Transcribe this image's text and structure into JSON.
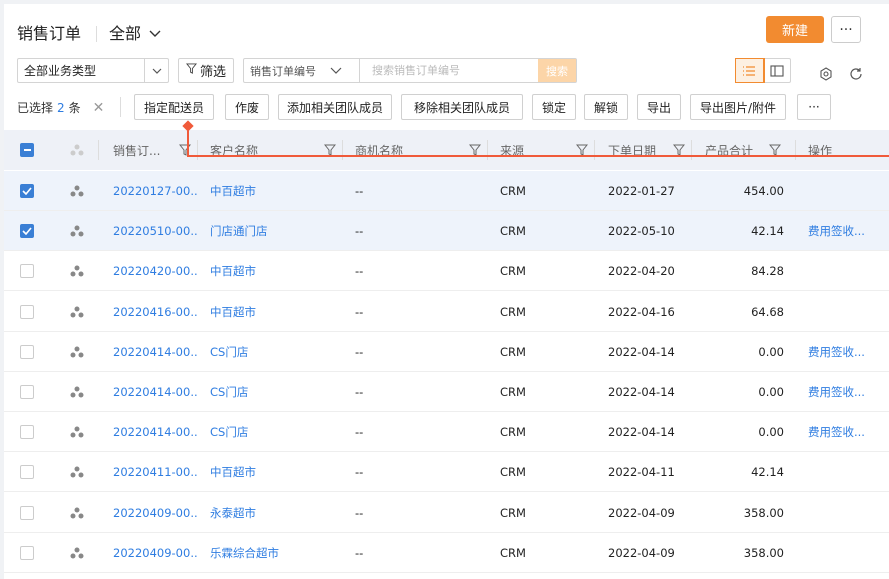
{
  "header": {
    "title": "销售订单",
    "view": "全部",
    "new_label": "新建",
    "more_label": "···"
  },
  "toolbar": {
    "type_select": "全部业务类型",
    "filter_label": "筛选",
    "search_field": "销售订单编号",
    "search_placeholder": "搜索销售订单编号",
    "search_button": "搜索"
  },
  "selection": {
    "prefix": "已选择",
    "count": "2",
    "suffix": "条",
    "actions": [
      "指定配送员",
      "作废",
      "添加相关团队成员",
      "移除相关团队成员",
      "锁定",
      "解锁",
      "导出",
      "导出图片/附件",
      "···"
    ]
  },
  "columns": [
    "销售订...",
    "客户名称",
    "商机名称",
    "来源",
    "下单日期",
    "产品合计",
    "操作"
  ],
  "rows": [
    {
      "checked": true,
      "order": "20220127-00...",
      "customer": "中百超市",
      "opportunity": "--",
      "source": "CRM",
      "date": "2022-01-27",
      "total": "454.00",
      "op": ""
    },
    {
      "checked": true,
      "order": "20220510-00...",
      "customer": "门店通门店",
      "opportunity": "--",
      "source": "CRM",
      "date": "2022-05-10",
      "total": "42.14",
      "op": "费用签收..."
    },
    {
      "checked": false,
      "order": "20220420-00...",
      "customer": "中百超市",
      "opportunity": "--",
      "source": "CRM",
      "date": "2022-04-20",
      "total": "84.28",
      "op": ""
    },
    {
      "checked": false,
      "order": "20220416-00...",
      "customer": "中百超市",
      "opportunity": "--",
      "source": "CRM",
      "date": "2022-04-16",
      "total": "64.68",
      "op": ""
    },
    {
      "checked": false,
      "order": "20220414-00...",
      "customer": "CS门店",
      "opportunity": "--",
      "source": "CRM",
      "date": "2022-04-14",
      "total": "0.00",
      "op": "费用签收..."
    },
    {
      "checked": false,
      "order": "20220414-00...",
      "customer": "CS门店",
      "opportunity": "--",
      "source": "CRM",
      "date": "2022-04-14",
      "total": "0.00",
      "op": "费用签收..."
    },
    {
      "checked": false,
      "order": "20220414-00...",
      "customer": "CS门店",
      "opportunity": "--",
      "source": "CRM",
      "date": "2022-04-14",
      "total": "0.00",
      "op": "费用签收..."
    },
    {
      "checked": false,
      "order": "20220411-00...",
      "customer": "中百超市",
      "opportunity": "--",
      "source": "CRM",
      "date": "2022-04-11",
      "total": "42.14",
      "op": ""
    },
    {
      "checked": false,
      "order": "20220409-00...",
      "customer": "永泰超市",
      "opportunity": "--",
      "source": "CRM",
      "date": "2022-04-09",
      "total": "358.00",
      "op": ""
    },
    {
      "checked": false,
      "order": "20220409-00...",
      "customer": "乐霖综合超市",
      "opportunity": "--",
      "source": "CRM",
      "date": "2022-04-09",
      "total": "358.00",
      "op": ""
    }
  ],
  "colors": {
    "accent": "#f28b30",
    "link": "#2f7de1",
    "checkbox": "#3a7fd5",
    "guide": "#f05a3a"
  }
}
